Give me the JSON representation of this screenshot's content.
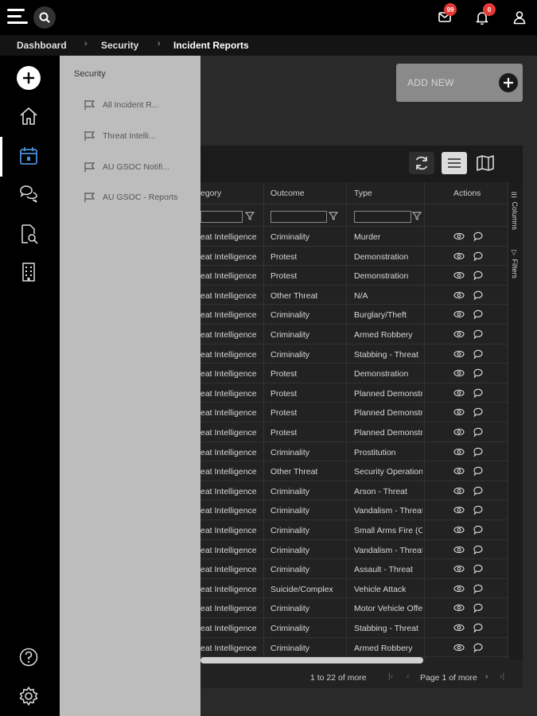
{
  "topbar": {
    "mail_badge": "99",
    "bell_badge": "0"
  },
  "breadcrumb": {
    "items": [
      "Dashboard",
      "Security",
      "Incident Reports"
    ]
  },
  "flyout": {
    "title": "Security",
    "items": [
      "All Incident R...",
      "Threat Intelli...",
      "AU GSOC Notifi...",
      "AU GSOC - Reports"
    ]
  },
  "add_new": {
    "label": "ADD NEW"
  },
  "grid": {
    "columns": [
      "egory",
      "Outcome",
      "Type",
      "Actions"
    ],
    "side_tabs": [
      "Columns",
      "Filters"
    ],
    "rows": [
      [
        "eat Intelligence",
        "Criminality",
        "Murder"
      ],
      [
        "eat Intelligence",
        "Protest",
        "Demonstration"
      ],
      [
        "eat Intelligence",
        "Protest",
        "Demonstration"
      ],
      [
        "eat Intelligence",
        "Other Threat",
        "N/A"
      ],
      [
        "eat Intelligence",
        "Criminality",
        "Burglary/Theft"
      ],
      [
        "eat Intelligence",
        "Criminality",
        "Armed Robbery"
      ],
      [
        "eat Intelligence",
        "Criminality",
        "Stabbing - Threat"
      ],
      [
        "eat Intelligence",
        "Protest",
        "Demonstration"
      ],
      [
        "eat Intelligence",
        "Protest",
        "Planned Demonstr"
      ],
      [
        "eat Intelligence",
        "Protest",
        "Planned Demonstr"
      ],
      [
        "eat Intelligence",
        "Protest",
        "Planned Demonstr"
      ],
      [
        "eat Intelligence",
        "Criminality",
        "Prostitution"
      ],
      [
        "eat Intelligence",
        "Other Threat",
        "Security Operation"
      ],
      [
        "eat Intelligence",
        "Criminality",
        "Arson - Threat"
      ],
      [
        "eat Intelligence",
        "Criminality",
        "Vandalism - Threat"
      ],
      [
        "eat Intelligence",
        "Criminality",
        "Small Arms Fire (C"
      ],
      [
        "eat Intelligence",
        "Criminality",
        "Vandalism - Threat"
      ],
      [
        "eat Intelligence",
        "Criminality",
        "Assault - Threat"
      ],
      [
        "eat Intelligence",
        "Suicide/Complex",
        "Vehicle Attack"
      ],
      [
        "eat Intelligence",
        "Criminality",
        "Motor Vehicle Offe"
      ],
      [
        "eat Intelligence",
        "Criminality",
        "Stabbing - Threat"
      ],
      [
        "eat Intelligence",
        "Criminality",
        "Armed Robbery"
      ]
    ],
    "footer": {
      "range": "1 to 22 of more",
      "page": "Page 1 of more"
    }
  },
  "colors": {
    "accent_blue": "#4a90d9",
    "badge_red": "#e53935",
    "flyout_bg": "#bdbdbd"
  }
}
